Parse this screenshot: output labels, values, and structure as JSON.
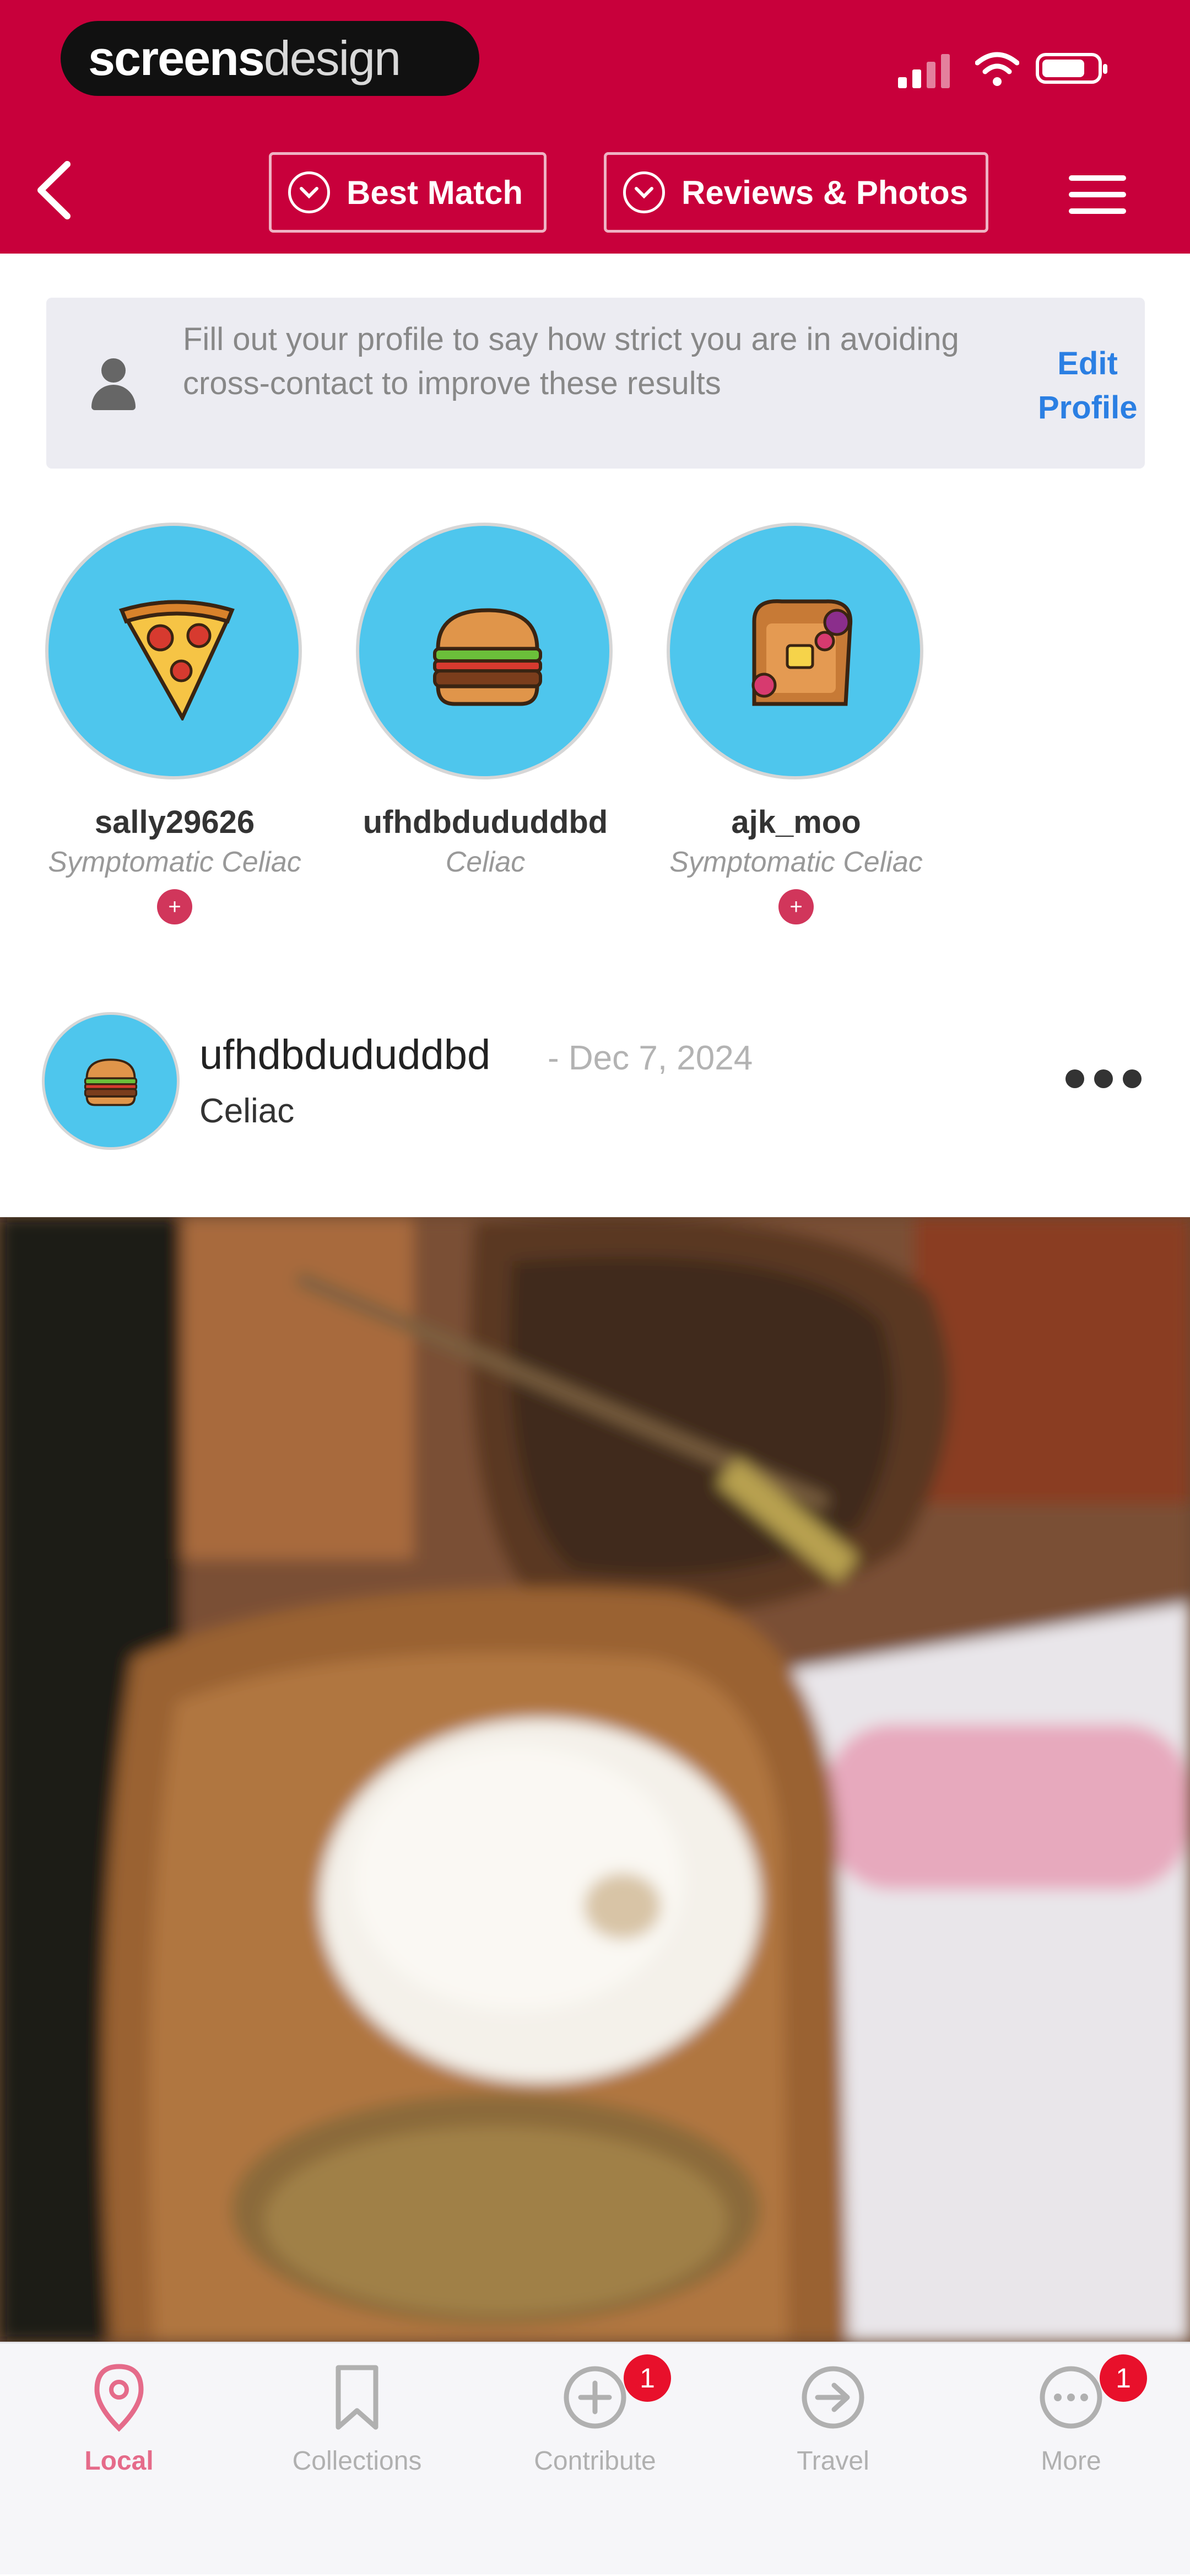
{
  "header": {
    "brand": {
      "bold": "screens",
      "light": "design"
    },
    "best_match_label": "Best Match",
    "reviews_photos_label": "Reviews & Photos"
  },
  "profile_banner": {
    "text": "Fill out your profile to say how strict you are in avoiding cross-contact to improve these results",
    "edit_label": "Edit Profile"
  },
  "reviewers": [
    {
      "name": "sally29626",
      "diet": "Symptomatic Celiac",
      "icon": "pizza-icon"
    },
    {
      "name": "ufhdbdududdbd",
      "diet": "Celiac",
      "icon": "burger-icon"
    },
    {
      "name": "ajk_moo",
      "diet": "Symptomatic Celiac",
      "icon": "toast-icon"
    }
  ],
  "post": {
    "user": "ufhdbdududdbd",
    "date": "- Dec 7, 2024",
    "diet": "Celiac",
    "photo": "rice-plate-photo"
  },
  "bottom_nav": {
    "items": [
      {
        "label": "Local",
        "icon": "location-pin-icon",
        "active": true
      },
      {
        "label": "Collections",
        "icon": "bookmark-icon"
      },
      {
        "label": "Contribute",
        "icon": "plus-circle-icon",
        "badge": "1"
      },
      {
        "label": "Travel",
        "icon": "arrow-circle-icon"
      },
      {
        "label": "More",
        "icon": "ellipsis-circle-icon",
        "badge": "1"
      }
    ]
  },
  "colors": {
    "brand_red": "#c8003b",
    "accent_blue": "#2b7fe3",
    "avatar_bg": "#4ec6ed",
    "badge_red": "#e8102b",
    "active_pink": "#e56b8a"
  }
}
